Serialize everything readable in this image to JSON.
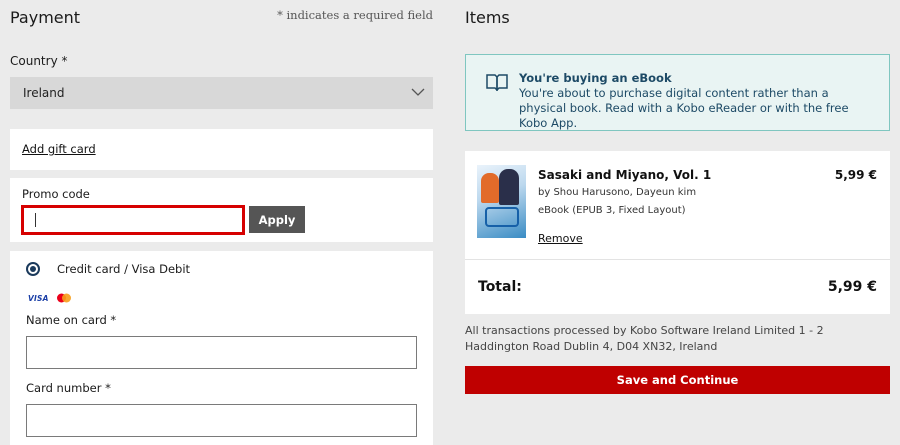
{
  "payment": {
    "title": "Payment",
    "required_note": "* indicates a required field",
    "country_label": "Country *",
    "country_value": "Ireland",
    "gift_card_link": "Add gift card",
    "promo_label": "Promo code",
    "promo_value": "",
    "apply_label": "Apply",
    "method_label": "Credit card / Visa Debit",
    "visa_logo": "VISA",
    "name_label": "Name on card *",
    "card_number_label": "Card number *"
  },
  "items": {
    "title": "Items",
    "notice_title": "You're buying an eBook",
    "notice_text": "You're about to purchase digital content rather than a physical book. Read with a Kobo eReader or with the free Kobo App.",
    "item": {
      "title": "Sasaki and Miyano, Vol. 1",
      "price": "5,99 €",
      "authors": "by Shou Harusono, Dayeun kim",
      "format": "eBook (EPUB 3, Fixed Layout)",
      "remove_label": "Remove"
    },
    "total_label": "Total:",
    "total_value": "5,99 €",
    "legal": "All transactions processed by Kobo Software Ireland Limited 1 - 2 Haddington Road Dublin 4, D04 XN32, Ireland",
    "save_label": "Save and Continue"
  },
  "colors": {
    "accent_red": "#bf0000",
    "notice_bg": "#e9f4f3",
    "notice_border": "#7fc6c0",
    "focus_border": "#d60000"
  }
}
